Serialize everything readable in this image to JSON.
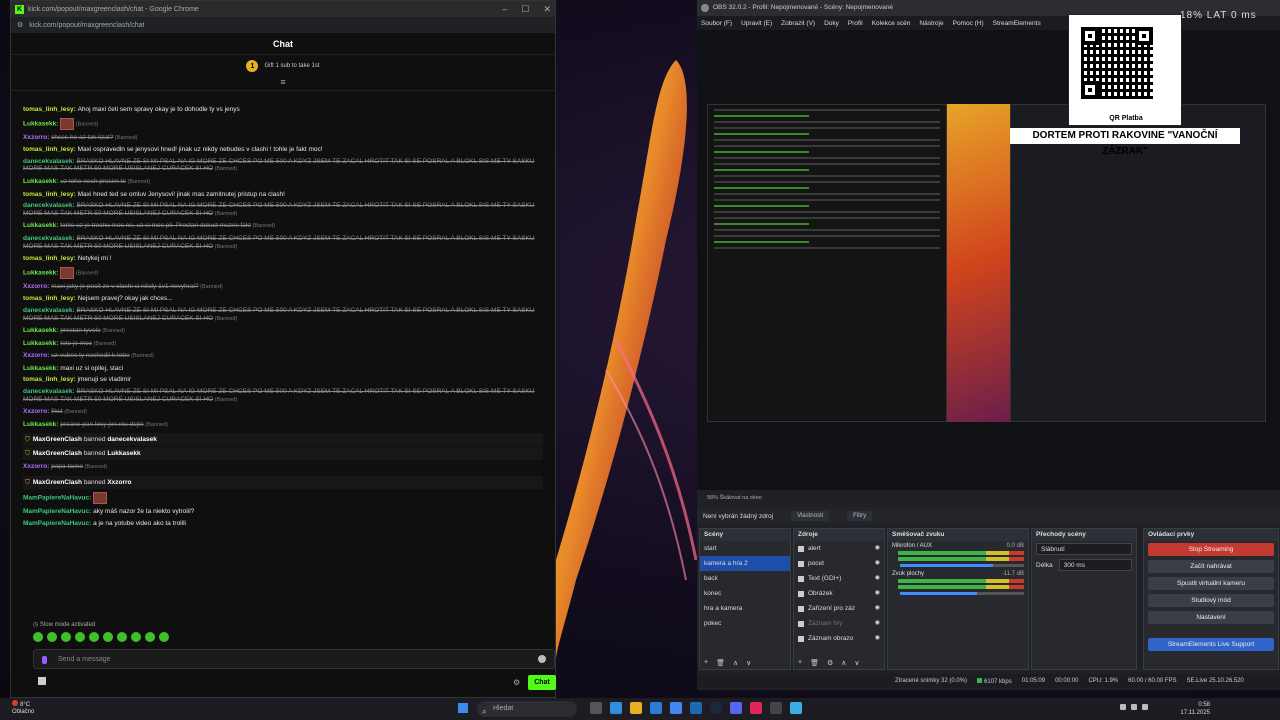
{
  "chrome": {
    "title": "kick.com/popout/maxgreenclash/chat - Google Chrome",
    "address": "kick.com/popout/maxgreenclash/chat"
  },
  "chat": {
    "header": "Chat",
    "gift_text": "Gift 1 sub to take 1st",
    "banned_tag": "(Banned)",
    "messages": [
      {
        "user": "tomas_linh_lesy",
        "color": "#c7e83a",
        "text": "Ahoj maxi četi sem spravy okay je to dohodle ty vs jenys",
        "deleted": false
      },
      {
        "user": "Lukkasekk",
        "color": "#6be84a",
        "text": "",
        "deleted": true,
        "emote": true
      },
      {
        "user": "Xxzorro",
        "color": "#b070ff",
        "text": "chces ho az tak lizat?",
        "deleted": true
      },
      {
        "user": "tomas_linh_lesy",
        "color": "#c7e83a",
        "text": "Maxi ospravedln se jenysovi hned! jinak uz nikdy nebudes v clashi ! tohle je fakt moc!",
        "deleted": false
      },
      {
        "user": "danecekvalasek",
        "color": "#3ec87a",
        "text": "BRASKO HLAVNE ZE SI MI PSAL NA IG MORE ZE CHCES PO ME 500 A KDYZ JSEM TE ZACAL HROTIT TAK SI SE POSRAL A BLOKL SIS ME TY SASKU MORE MAS TAK METR 50 MORE USISLANEJ CURACEK SI HO",
        "deleted": true
      },
      {
        "user": "Lukkasekk",
        "color": "#6be84a",
        "text": "uz toho nech prosim te",
        "deleted": true
      },
      {
        "user": "tomas_linh_lesy",
        "color": "#c7e83a",
        "text": "Maxi hned ted se omluv Jenysovi! jinak mas zamitnutej pristup na clash!",
        "deleted": false
      },
      {
        "user": "danecekvalasek",
        "color": "#3ec87a",
        "text": "BRASKO HLAVNE ZE SI MI PSAL NA IG MORE ZE CHCES PO ME 500 A KDYZ JSEM TE ZACAL HROTIT TAK SI SE POSRAL A BLOKL SIS ME TY SASKU MORE MAS TAK METR 50 MORE USISLANEJ CURACEK SI HO",
        "deleted": true
      },
      {
        "user": "Lukkasekk",
        "color": "#6be84a",
        "text": "tohle uz je trochu moc ne, uz si moc pil. Prestan dokud muzes fakt",
        "deleted": true
      },
      {
        "user": "danecekvalasek",
        "color": "#3ec87a",
        "text": "BRASKO HLAVNE ZE SI MI PSAL NA IG MORE ZE CHCES PO ME 500 A KDYZ JSEM TE ZACAL HROTIT TAK SI SE POSRAL A BLOKL SIS ME TY SASKU MORE MAS TAK METR 50 MORE USISLANEJ CURACEK SI HO",
        "deleted": true
      },
      {
        "user": "tomas_linh_lesy",
        "color": "#c7e83a",
        "text": "Netykej mi !",
        "deleted": false
      },
      {
        "user": "Lukkasekk",
        "color": "#6be84a",
        "text": "",
        "deleted": true,
        "emote": true
      },
      {
        "user": "Xxzorro",
        "color": "#b070ff",
        "text": "maxi jaky je pocit ze v clashi si nikdy 1v1 nevyhral?",
        "deleted": true
      },
      {
        "user": "tomas_linh_lesy",
        "color": "#c7e83a",
        "text": "Nejsem pravej? okay jak chces...",
        "deleted": false
      },
      {
        "user": "danecekvalasek",
        "color": "#3ec87a",
        "text": "BRASKO HLAVNE ZE SI MI PSAL NA IG MORE ZE CHCES PO ME 500 A KDYZ JSEM TE ZACAL HROTIT TAK SI SE POSRAL A BLOKL SIS ME TY SASKU MORE MAS TAK METR 50 MORE USISLANEJ CURACEK SI HO",
        "deleted": true
      },
      {
        "user": "Lukkasekk",
        "color": "#6be84a",
        "text": "prestan tyvole",
        "deleted": true
      },
      {
        "user": "Lukkasekk",
        "color": "#6be84a",
        "text": "toto je moc",
        "deleted": true
      },
      {
        "user": "Xxzorro",
        "color": "#b070ff",
        "text": "uz vubec ty nechodil k tobe",
        "deleted": true
      },
      {
        "user": "Lukkasekk",
        "color": "#6be84a",
        "text": "maxi uz si opilej, staci",
        "deleted": false
      },
      {
        "user": "tomas_linh_lesy",
        "color": "#c7e83a",
        "text": "jmenuji se vladimir",
        "deleted": false
      },
      {
        "user": "danecekvalasek",
        "color": "#3ec87a",
        "text": "BRASKO HLAVNE ZE SI MI PSAL NA IG MORE ZE CHCES PO ME 500 A KDYZ JSEM TE ZACAL HROTIT TAK SI SE POSRAL A BLOKL SIS ME TY SASKU MORE MAS TAK METR 50 MORE USISLANEJ CURACEK SI HO",
        "deleted": true
      },
      {
        "user": "Xxzorro",
        "color": "#b070ff",
        "text": "fikst",
        "deleted": true
      },
      {
        "user": "Lukkasekk",
        "color": "#6be84a",
        "text": "preane pan lesy jen mu dejte",
        "deleted": true
      }
    ],
    "system": [
      {
        "mod": "MaxGreenClash",
        "action": "banned",
        "target": "danecekvalasek"
      },
      {
        "mod": "MaxGreenClash",
        "action": "banned",
        "target": "Lukkasekk"
      }
    ],
    "tail_msg": {
      "user": "Xxzorro",
      "color": "#b070ff",
      "text": "papa tasko",
      "deleted": true
    },
    "system3": {
      "mod": "MaxGreenClash",
      "action": "banned",
      "target": "Xxzorro"
    },
    "final": [
      {
        "user": "MamPapiereNaHavuc",
        "color": "#3ec87a",
        "text": "",
        "emote": true
      },
      {
        "user": "MamPapiereNaHavuc",
        "color": "#3ec87a",
        "text": "aky máš nazor že ta niekto vytrolil?"
      },
      {
        "user": "MamPapiereNaHavuc",
        "color": "#3ec87a",
        "text": "a je na yotube video ako ta trolili"
      }
    ],
    "slow_mode": "Slow mode activated",
    "input_placeholder": "Send a message",
    "send_label": "Chat"
  },
  "obs": {
    "title": "OBS 32.0.2 - Profil: Nepojmenované - Scény: Nepojmenované",
    "menu": [
      "Soubor (F)",
      "Upravit (E)",
      "Zobrazit (V)",
      "Doky",
      "Profil",
      "Kolekce scén",
      "Nástroje",
      "Pomoc (H)",
      "StreamElements"
    ],
    "toolbar_text": "58%    Škálovat na okno",
    "no_source": "Není vybrán žádný zdroj",
    "props_btn": "Vlastnosti",
    "filters_btn": "Filtry",
    "scenes_title": "Scény",
    "scenes": [
      "start",
      "kamera a hra 2",
      "back",
      "konec",
      "hra a kamera",
      "pokec"
    ],
    "sources_title": "Zdroje",
    "sources": [
      {
        "name": "alert",
        "dim": false
      },
      {
        "name": "pocet",
        "dim": false
      },
      {
        "name": "Text (GDI+)",
        "dim": false
      },
      {
        "name": "Obrázek",
        "dim": false
      },
      {
        "name": "Zařízení pro záz",
        "dim": false
      },
      {
        "name": "Záznam hry",
        "dim": true
      },
      {
        "name": "Záznam obrazo",
        "dim": false
      }
    ],
    "mixer_title": "Směšovač zvuku",
    "mixer": [
      {
        "name": "Mikrofon / AUX",
        "db": "0.0 dB",
        "level": 0.75
      },
      {
        "name": "Zvuk plochy",
        "db": "-11.7 dB",
        "level": 0.62
      }
    ],
    "transitions_title": "Přechody scény",
    "transition": "Slábnutí",
    "duration_label": "Délka",
    "duration": "300 ms",
    "controls_title": "Ovládací prvky",
    "controls": [
      "Stop Streaming",
      "Začít nahrávat",
      "Spustit virtuální kameru",
      "Studiový mód",
      "Nastavení"
    ],
    "se_support": "StreamElements Live Support",
    "status": {
      "dropped": "Ztracené snímky 32 (0.0%)",
      "kbps": "6107 kbps",
      "stream_time": "01:05:09",
      "rec_time": "00:00:00",
      "cpu": "CPU: 1.9%",
      "fps": "60.00 / 60.00 FPS",
      "version": "SE.Live 25.10.26.520"
    }
  },
  "overlay": {
    "qr_label": "QR Platba",
    "charity": "DORTEM PROTI RAKOVINE \"VANOČNÍ ZÁZRAK\"",
    "topright": "18%   LAT 0 ms"
  },
  "taskbar": {
    "weather_temp": "8°C",
    "weather_desc": "Oblačno",
    "search": "Hledat",
    "time": "0:58",
    "date": "17.11.2025"
  }
}
